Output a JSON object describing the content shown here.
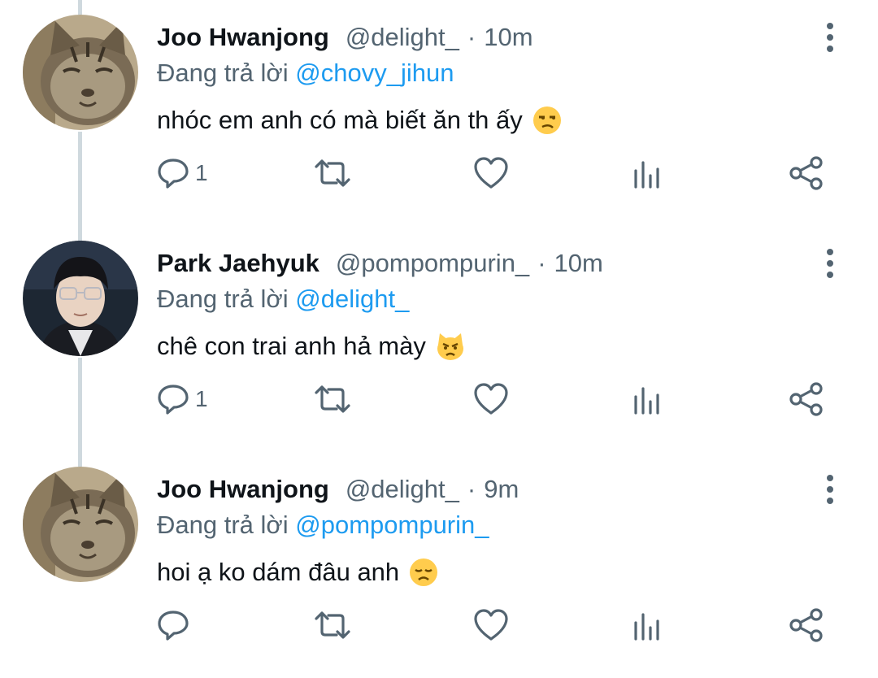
{
  "colors": {
    "accent": "#1d9bf0",
    "secondary": "#536471",
    "text": "#0f1419",
    "thread": "#cfd9de"
  },
  "tweets": [
    {
      "name": "Joo Hwanjong",
      "handle": "@delight_",
      "separator": "·",
      "time": "10m",
      "reply_prefix": "Đang trả lời",
      "reply_to": "@chovy_jihun",
      "text": "nhóc em anh có mà biết ăn th ấy",
      "emoji": "unamused-face",
      "avatar": "cat-avatar",
      "reply_count": "1"
    },
    {
      "name": "Park Jaehyuk",
      "handle": "@pompompurin_",
      "separator": "·",
      "time": "10m",
      "reply_prefix": "Đang trả lời",
      "reply_to": "@delight_",
      "text": "chê con trai anh hả mày",
      "emoji": "pouting-cat-face",
      "avatar": "person-with-glasses-avatar",
      "reply_count": "1"
    },
    {
      "name": "Joo Hwanjong",
      "handle": "@delight_",
      "separator": "·",
      "time": "9m",
      "reply_prefix": "Đang trả lời",
      "reply_to": "@pompompurin_",
      "text": "hoi ạ ko dám đâu anh",
      "emoji": "disappointed-face",
      "avatar": "cat-avatar",
      "reply_count": ""
    }
  ],
  "action_icons": [
    "reply-icon",
    "retweet-icon",
    "like-icon",
    "analytics-icon",
    "share-icon"
  ]
}
